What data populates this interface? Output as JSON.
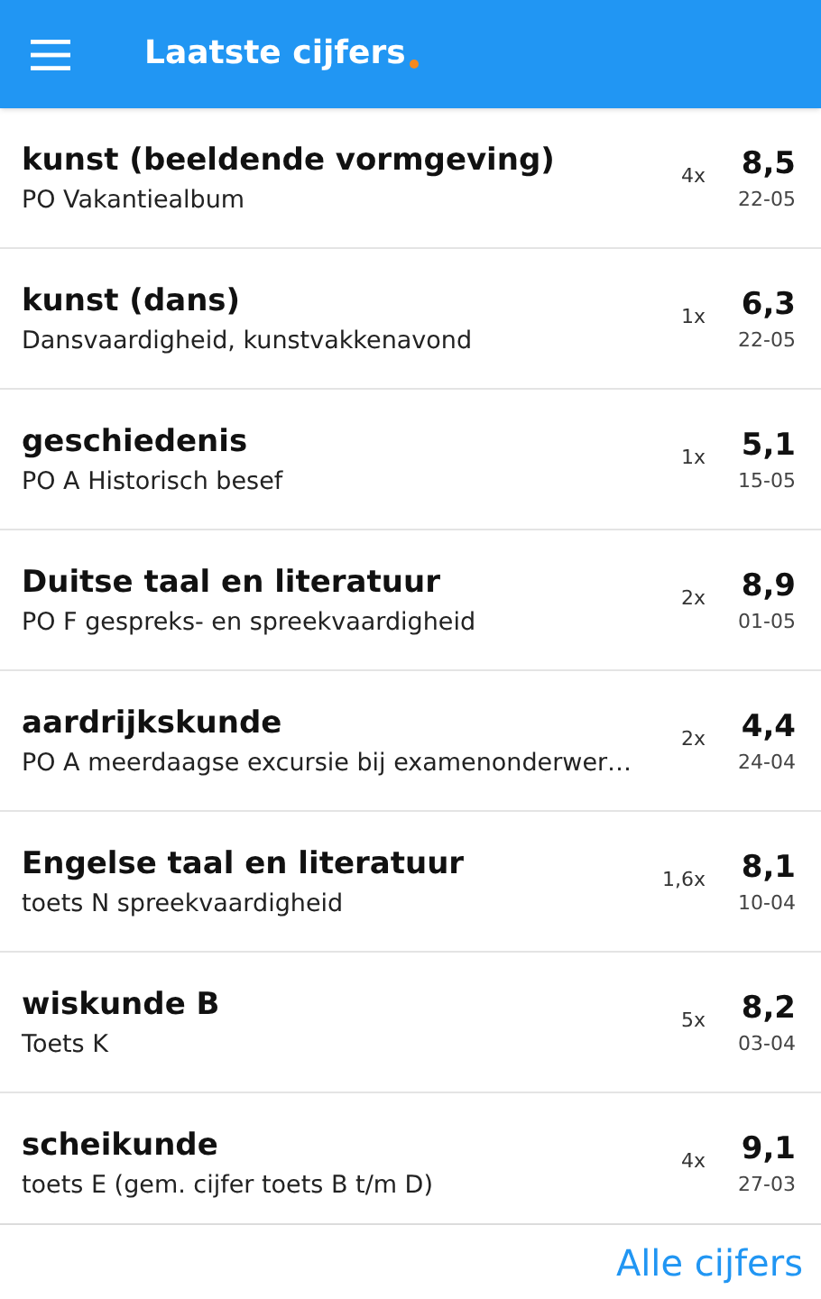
{
  "app_bar": {
    "title": "Laatste cijfers"
  },
  "grades": [
    {
      "subject": "kunst (beeldende vormgeving)",
      "description": "PO Vakantiealbum",
      "weight": "4x",
      "grade": "8,5",
      "date": "22-05"
    },
    {
      "subject": "kunst (dans)",
      "description": "Dansvaardigheid, kunstvakkenavond",
      "weight": "1x",
      "grade": "6,3",
      "date": "22-05"
    },
    {
      "subject": "geschiedenis",
      "description": "PO A Historisch besef",
      "weight": "1x",
      "grade": "5,1",
      "date": "15-05"
    },
    {
      "subject": "Duitse taal en literatuur",
      "description": "PO F gespreks- en spreekvaardigheid",
      "weight": "2x",
      "grade": "8,9",
      "date": "01-05"
    },
    {
      "subject": "aardrijkskunde",
      "description": "PO A meerdaagse excursie bij examenonderwer…",
      "weight": "2x",
      "grade": "4,4",
      "date": "24-04"
    },
    {
      "subject": "Engelse taal en literatuur",
      "description": "toets N spreekvaardigheid",
      "weight": "1,6x",
      "grade": "8,1",
      "date": "10-04"
    },
    {
      "subject": "wiskunde B",
      "description": "Toets K",
      "weight": "5x",
      "grade": "8,2",
      "date": "03-04"
    },
    {
      "subject": "scheikunde",
      "description": "toets E (gem. cijfer toets B t/m D)",
      "weight": "4x",
      "grade": "9,1",
      "date": "27-03"
    }
  ],
  "footer": {
    "link": "Alle cijfers"
  }
}
